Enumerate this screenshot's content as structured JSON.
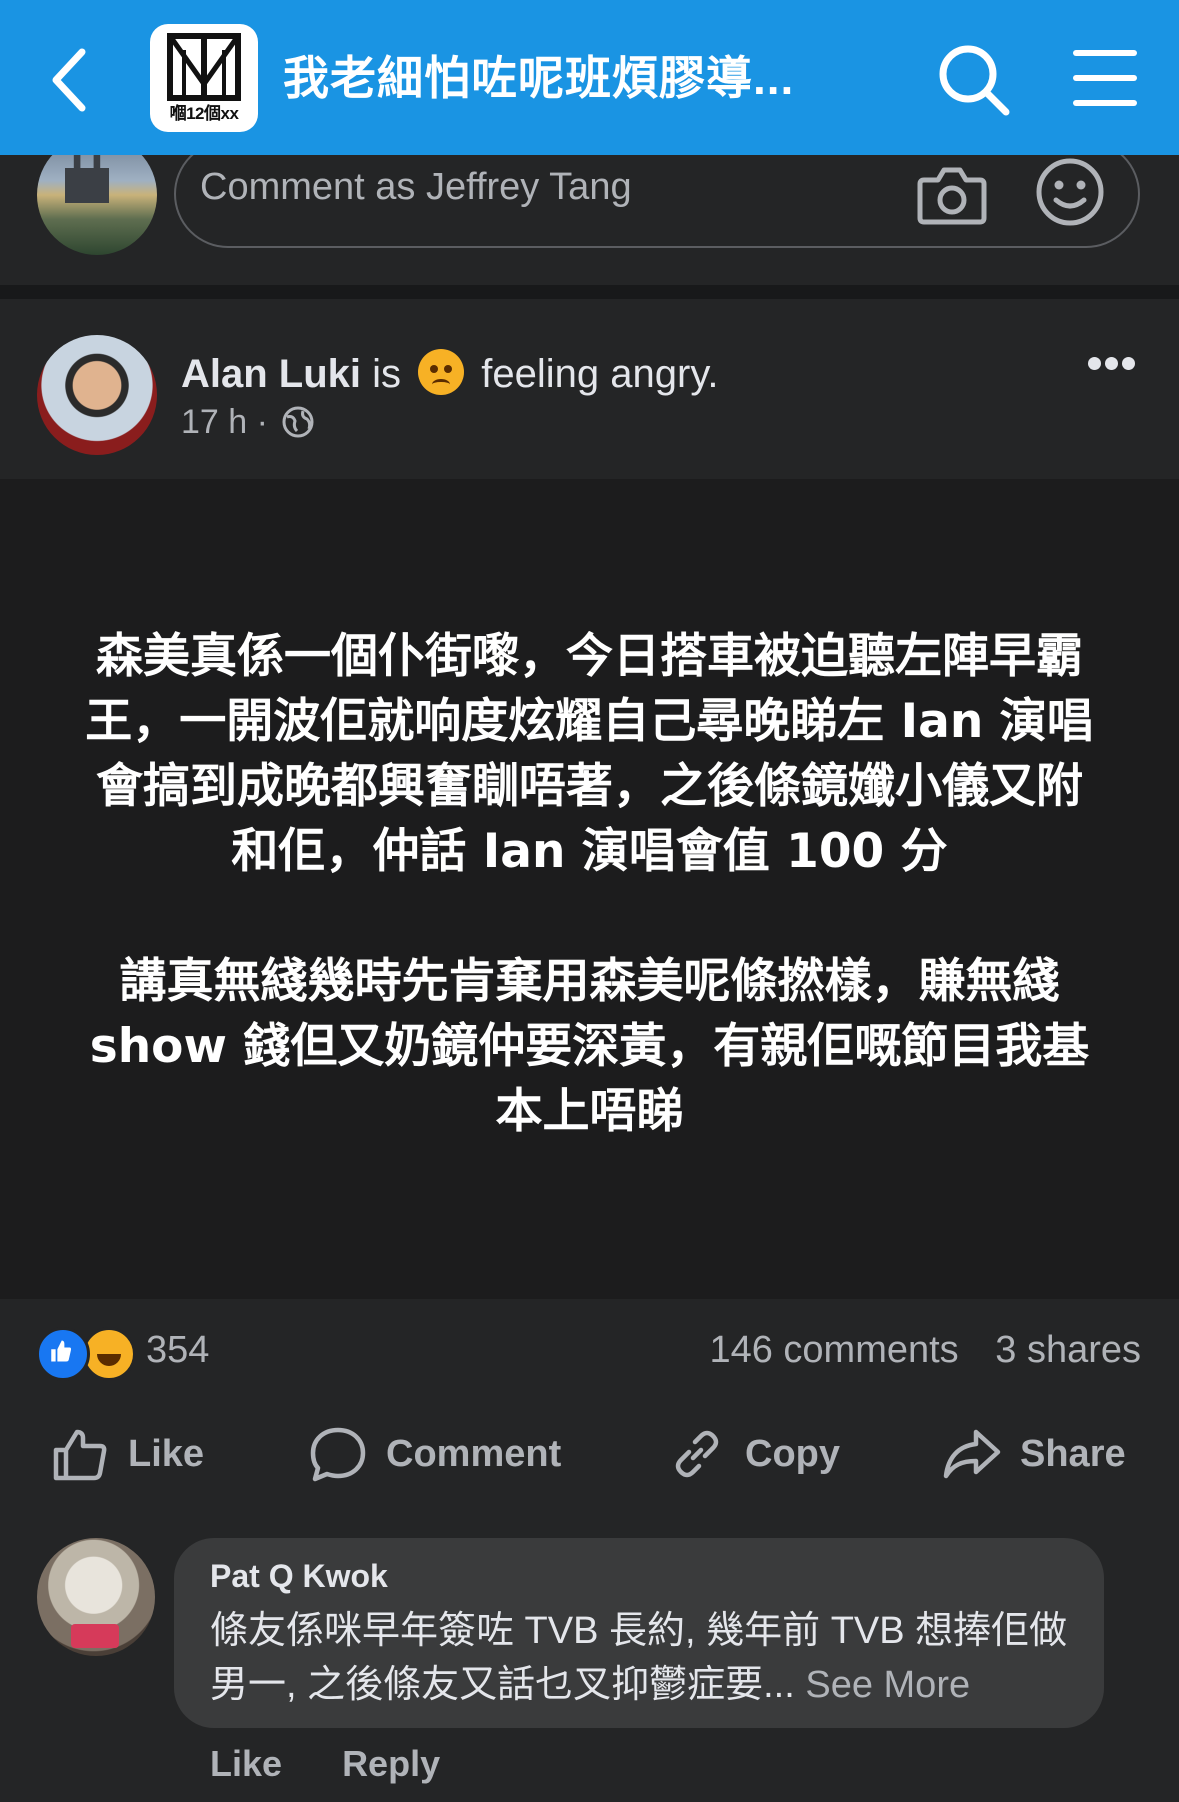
{
  "header": {
    "group_logo_text": "嗰12個xx",
    "group_title": "我老細怕咗呢班煩膠導..."
  },
  "composer": {
    "placeholder": "Comment as Jeffrey Tang"
  },
  "post": {
    "author": "Alan Luki",
    "feeling_prefix": "is",
    "feeling_text": "feeling angry.",
    "time": "17 h",
    "separator": "·",
    "paragraphs": [
      "森美真係一個仆街嚟，今日搭車被迫聽左陣早霸王，一開波佢就响度炫耀自己尋晚睇左 Ian 演唱會搞到成晚都興奮瞓唔著，之後條鏡孅小儀又附和佢，仲話 Ian 演唱會值 100 分",
      "講真無綫幾時先肯棄用森美呢條撚樣，賺無綫 show 錢但又奶鏡仲要深黃，有親佢嘅節目我基本上唔睇"
    ],
    "background_color": "#1c1c1d",
    "reaction_count": "354",
    "comments_count": "146 comments",
    "shares_count": "3 shares"
  },
  "actions": {
    "like": "Like",
    "comment": "Comment",
    "copy": "Copy",
    "share": "Share"
  },
  "comment": {
    "name": "Pat Q Kwok",
    "text": "條友係咪早年簽咗 TVB 長約, 幾年前 TVB 想捧佢做男一, 之後條友又話乜叉抑鬱症要...",
    "see_more": "See More",
    "like": "Like",
    "reply": "Reply"
  },
  "colors": {
    "header_blue": "#1a94e3",
    "like_blue": "#1877f2",
    "background": "#242526"
  }
}
